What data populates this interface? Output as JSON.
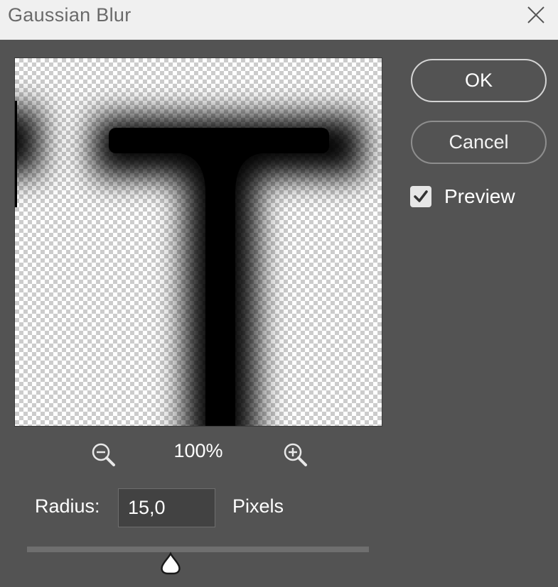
{
  "window": {
    "title": "Gaussian Blur"
  },
  "buttons": {
    "ok_label": "OK",
    "cancel_label": "Cancel"
  },
  "preview_option": {
    "label": "Preview",
    "checked": true
  },
  "zoom": {
    "level": "100%"
  },
  "radius": {
    "label": "Radius:",
    "value": "15,0",
    "unit": "Pixels",
    "slider_fraction": 0.42
  },
  "icons": {
    "close": "close-icon",
    "zoom_out": "zoom-out-icon",
    "zoom_in": "zoom-in-icon",
    "check": "checkmark-icon",
    "slider_thumb": "slider-thumb-icon"
  },
  "colors": {
    "dialog_background": "#535353",
    "titlebar_background": "#f0f0f0",
    "text": "#ffffff",
    "input_background": "#424242"
  }
}
